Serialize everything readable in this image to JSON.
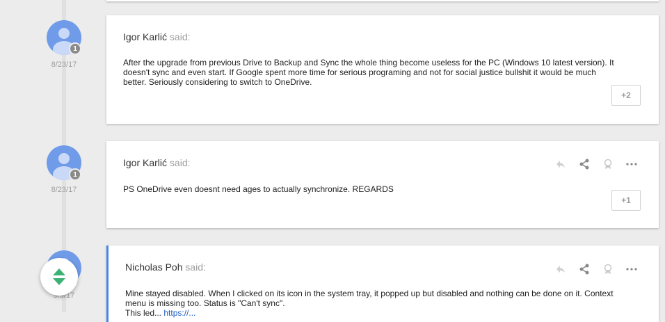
{
  "comments": [
    {
      "author": "Igor Karlić",
      "said": "said:",
      "date": "8/23/17",
      "badge": "1",
      "text": "After the upgrade from previous Drive to Backup and Sync the whole thing become useless for the PC (Windows 10 latest version). It doesn't sync and even start. If Google spent more time for serious programing and not for social justice bullshit it would be much better. Seriously considering to switch to OneDrive.",
      "plus_label": "+2"
    },
    {
      "author": "Igor Karlić",
      "said": "said:",
      "date": "8/23/17",
      "badge": "1",
      "text": "PS OneDrive even doesnt need ages to actually synchronize. REGARDS",
      "plus_label": "+1"
    },
    {
      "author": "Nicholas Poh",
      "said": "said:",
      "date": "9/9/17",
      "text": "Mine stayed disabled. When I clicked on its icon in the system tray, it popped up but disabled and nothing can be done on it. Context menu is missing too. Status is \"Can't sync\".",
      "text_line3_prefix": "This led...",
      "text_line3_link": "https://..."
    }
  ],
  "colors": {
    "accent": "#4a86e8",
    "avatar": "#6f9be8",
    "link": "#1a5cc4"
  },
  "icons": [
    "reply-icon",
    "share-icon",
    "award-icon",
    "more-icon",
    "expand-collapse-icon",
    "user-avatar-icon"
  ]
}
